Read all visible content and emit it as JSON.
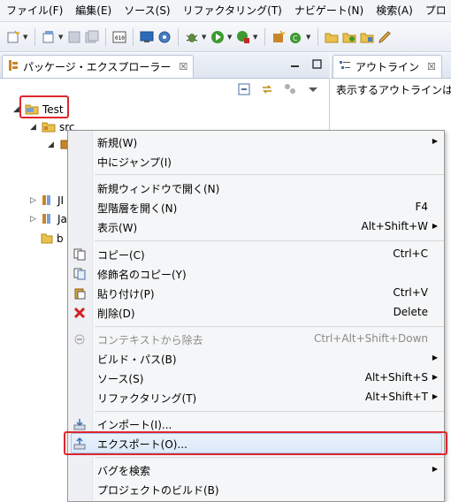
{
  "menubar": {
    "items": [
      "ファイル(F)",
      "編集(E)",
      "ソース(S)",
      "リファクタリング(T)",
      "ナビゲート(N)",
      "検索(A)",
      "プロ"
    ]
  },
  "left_view": {
    "title": "パッケージ・エクスプローラー",
    "close": "☒"
  },
  "right_view": {
    "title": "アウトライン",
    "close": "☒",
    "message": "表示するアウトラインは"
  },
  "tree": {
    "project": "Test",
    "src": "src",
    "jre": "JI",
    "ja": "Ja",
    "b": "b"
  },
  "context_menu": {
    "items": [
      {
        "label": "新規(W)",
        "shortcut": "",
        "submenu": true
      },
      {
        "label": "中にジャンプ(I)",
        "shortcut": "",
        "submenu": false
      },
      {
        "label": "新規ウィンドウで開く(N)",
        "shortcut": "",
        "submenu": false
      },
      {
        "label": "型階層を開く(N)",
        "shortcut": "F4",
        "submenu": false
      },
      {
        "label": "表示(W)",
        "shortcut": "Alt+Shift+W",
        "submenu": true
      },
      {
        "label": "コピー(C)",
        "shortcut": "Ctrl+C",
        "submenu": false
      },
      {
        "label": "修飾名のコピー(Y)",
        "shortcut": "",
        "submenu": false
      },
      {
        "label": "貼り付け(P)",
        "shortcut": "Ctrl+V",
        "submenu": false
      },
      {
        "label": "削除(D)",
        "shortcut": "Delete",
        "submenu": false
      },
      {
        "label": "コンテキストから除去",
        "shortcut": "Ctrl+Alt+Shift+Down",
        "submenu": false
      },
      {
        "label": "ビルド・パス(B)",
        "shortcut": "",
        "submenu": true
      },
      {
        "label": "ソース(S)",
        "shortcut": "Alt+Shift+S",
        "submenu": true
      },
      {
        "label": "リファクタリング(T)",
        "shortcut": "Alt+Shift+T",
        "submenu": true
      },
      {
        "label": "インポート(I)...",
        "shortcut": "",
        "submenu": false
      },
      {
        "label": "エクスポート(O)...",
        "shortcut": "",
        "submenu": false
      },
      {
        "label": "バグを検索",
        "shortcut": "",
        "submenu": true
      },
      {
        "label": "プロジェクトのビルド(B)",
        "shortcut": "",
        "submenu": false
      }
    ]
  },
  "colors": {
    "highlight_box": "#e0262e",
    "menu_bg": "#f5f6f7",
    "hover_bg": "#dbe9f9"
  }
}
